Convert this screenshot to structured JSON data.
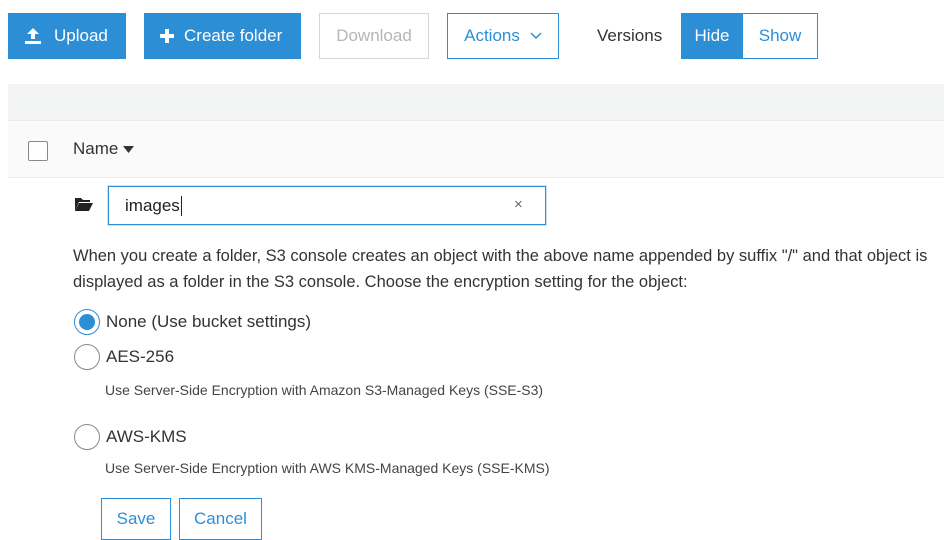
{
  "toolbar": {
    "upload_label": "Upload",
    "create_folder_label": "Create folder",
    "download_label": "Download",
    "actions_label": "Actions",
    "versions_label": "Versions",
    "hide_label": "Hide",
    "show_label": "Show"
  },
  "table": {
    "name_header": "Name"
  },
  "folder": {
    "input_value": "images",
    "clear_symbol": "×",
    "description": "When you create a folder, S3 console creates an object with the above name appended by suffix \"/\" and that object is displayed as a folder in the S3 console. Choose the encryption setting for the object:"
  },
  "encryption": {
    "options": [
      {
        "label": "None (Use bucket settings)",
        "description": "",
        "selected": true
      },
      {
        "label": "AES-256",
        "description": "Use Server-Side Encryption with Amazon S3-Managed Keys (SSE-S3)",
        "selected": false
      },
      {
        "label": "AWS-KMS",
        "description": "Use Server-Side Encryption with AWS KMS-Managed Keys (SSE-KMS)",
        "selected": false
      }
    ]
  },
  "form": {
    "save_label": "Save",
    "cancel_label": "Cancel"
  },
  "colors": {
    "primary": "#2c8fd6",
    "disabled_text": "#b6b6b6",
    "band": "#f2f3f3"
  }
}
